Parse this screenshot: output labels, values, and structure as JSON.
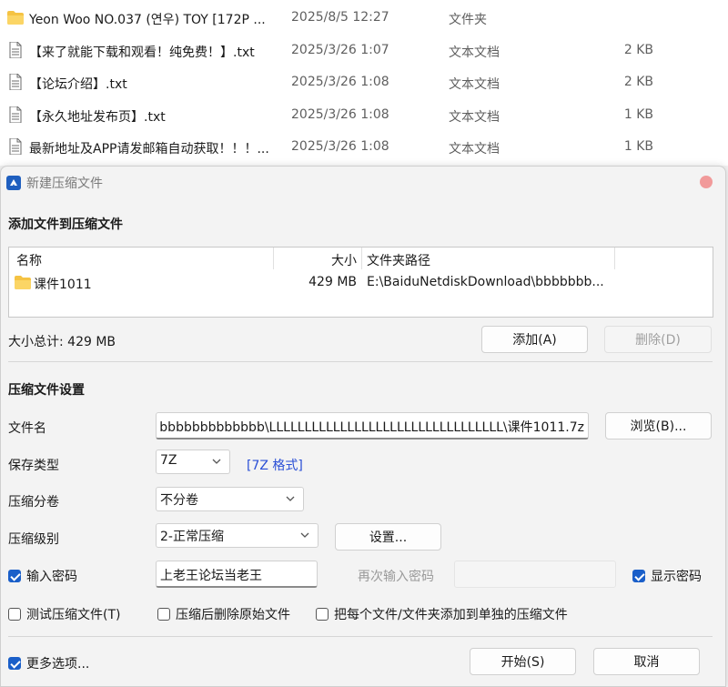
{
  "files": [
    {
      "name": "Yeon Woo NO.037 (연우) TOY [172P ...",
      "date": "2025/8/5 12:27",
      "type": "文件夹",
      "size": "",
      "icon": "folder-icon"
    },
    {
      "name": "【来了就能下载和观看！纯免费！】.txt",
      "date": "2025/3/26 1:07",
      "type": "文本文档",
      "size": "2 KB",
      "icon": "text-file-icon"
    },
    {
      "name": "【论坛介绍】.txt",
      "date": "2025/3/26 1:08",
      "type": "文本文档",
      "size": "2 KB",
      "icon": "text-file-icon"
    },
    {
      "name": "【永久地址发布页】.txt",
      "date": "2025/3/26 1:08",
      "type": "文本文档",
      "size": "1 KB",
      "icon": "text-file-icon"
    },
    {
      "name": "最新地址及APP请发邮箱自动获取！！！...",
      "date": "2025/3/26 1:08",
      "type": "文本文档",
      "size": "1 KB",
      "icon": "text-file-icon"
    }
  ],
  "dialog": {
    "title": "新建压缩文件",
    "add_section": "添加文件到压缩文件",
    "table": {
      "headers": {
        "name": "名称",
        "size": "大小",
        "path": "文件夹路径"
      },
      "rows": [
        {
          "name": "课件1011",
          "size": "429 MB",
          "path": "E:\\BaiduNetdiskDownload\\bbbbbbb..."
        }
      ]
    },
    "total_size": "大小总计: 429 MB",
    "add_button": "添加(A)",
    "delete_button": "删除(D)",
    "settings_section": "压缩文件设置",
    "filename_label": "文件名",
    "filename_value": "bbbbbbbbbbbbb\\LLLLLLLLLLLLLLLLLLLLLLLLLLLLLLLLL\\课件1011.7z",
    "browse_button": "浏览(B)...",
    "save_type_label": "保存类型",
    "save_type_value": "7Z",
    "format_link": "[7Z 格式]",
    "split_label": "压缩分卷",
    "split_value": "不分卷",
    "level_label": "压缩级别",
    "level_value": "2-正常压缩",
    "settings_button": "设置...",
    "password_check": "输入密码",
    "password_value": "上老王论坛当老王",
    "reenter_label": "再次输入密码",
    "show_password": "显示密码",
    "test_check": "测试压缩文件(T)",
    "delete_after_check": "压缩后删除原始文件",
    "each_file_check": "把每个文件/文件夹添加到单独的压缩文件",
    "more_options": "更多选项...",
    "start_button": "开始(S)",
    "cancel_button": "取消"
  },
  "colors": {
    "accent": "#1a5fc9",
    "link": "#2a4fd6",
    "folder": "#f5c343"
  }
}
